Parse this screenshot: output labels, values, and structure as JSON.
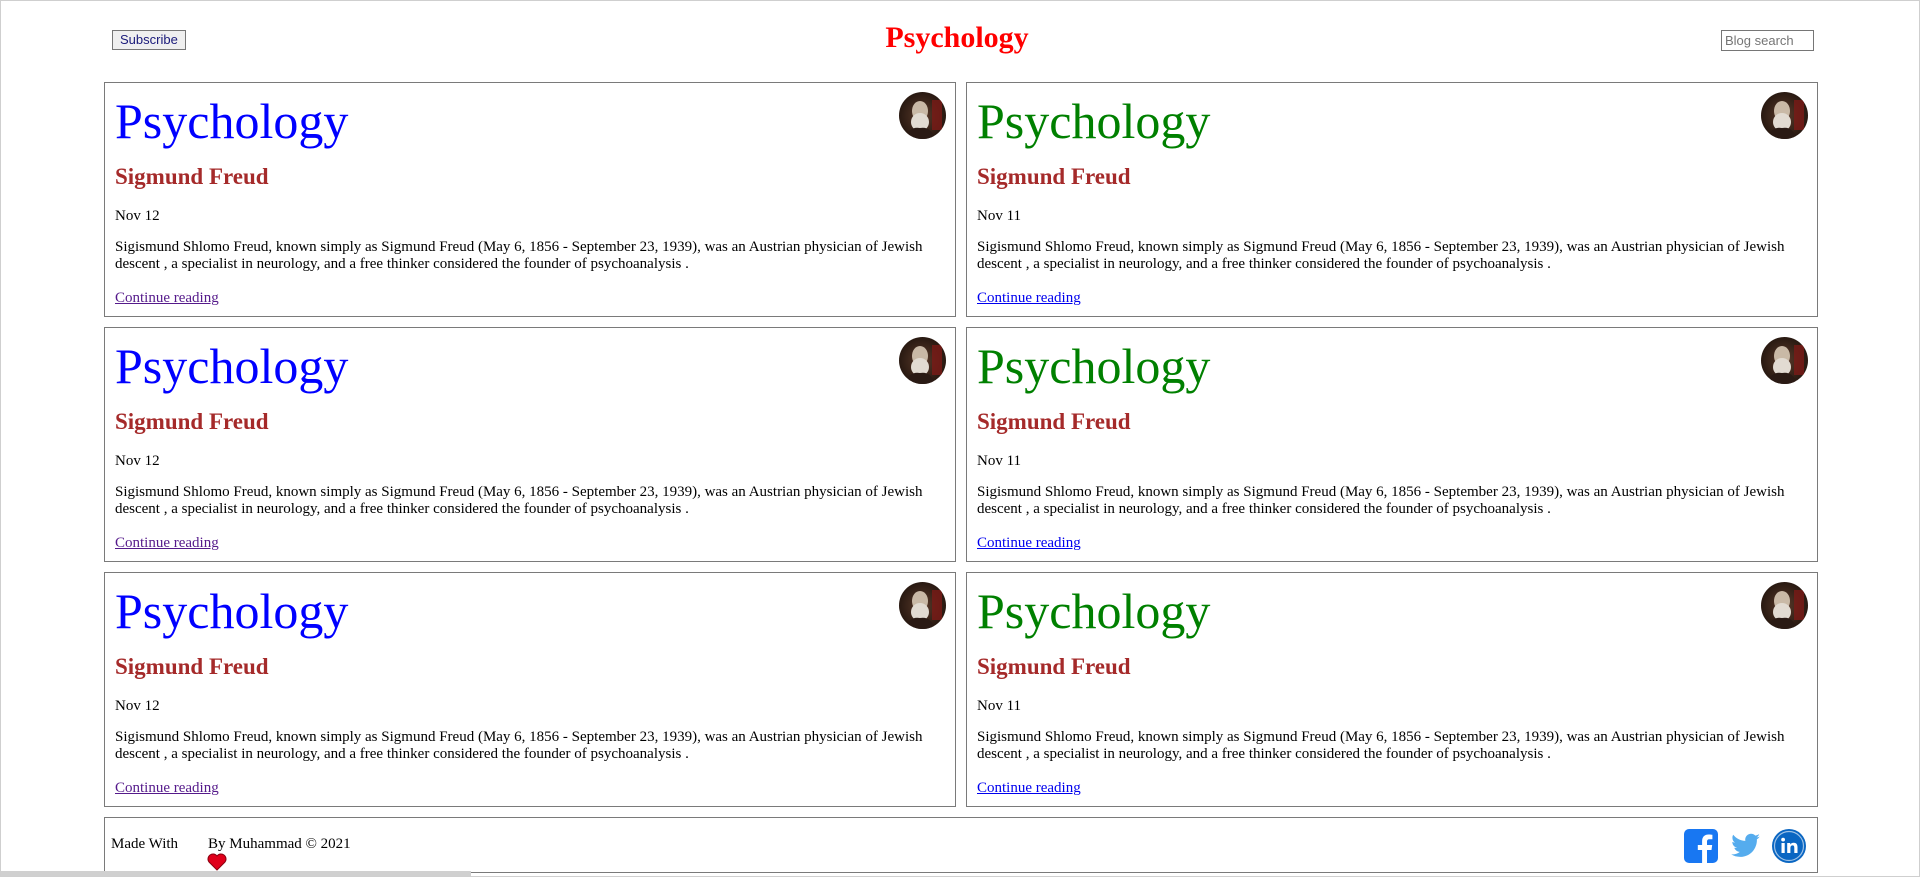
{
  "header": {
    "subscribe_label": "Subscribe",
    "site_title": "Psychology",
    "search_placeholder": "Blog search"
  },
  "posts": [
    {
      "heading": "Psychology",
      "author": "Sigmund Freud",
      "date": "Nov 12",
      "excerpt": "Sigismund Shlomo Freud, known simply as Sigmund Freud (May 6, 1856 - September 23, 1939), was an Austrian physician of Jewish descent , a specialist in neurology, and a free thinker considered the founder of psychoanalysis .",
      "link": "Continue reading"
    },
    {
      "heading": "Psychology",
      "author": "Sigmund Freud",
      "date": "Nov 11",
      "excerpt": "Sigismund Shlomo Freud, known simply as Sigmund Freud (May 6, 1856 - September 23, 1939), was an Austrian physician of Jewish descent , a specialist in neurology, and a free thinker considered the founder of psychoanalysis .",
      "link": "Continue reading"
    },
    {
      "heading": "Psychology",
      "author": "Sigmund Freud",
      "date": "Nov 12",
      "excerpt": "Sigismund Shlomo Freud, known simply as Sigmund Freud (May 6, 1856 - September 23, 1939), was an Austrian physician of Jewish descent , a specialist in neurology, and a free thinker considered the founder of psychoanalysis .",
      "link": "Continue reading"
    },
    {
      "heading": "Psychology",
      "author": "Sigmund Freud",
      "date": "Nov 11",
      "excerpt": "Sigismund Shlomo Freud, known simply as Sigmund Freud (May 6, 1856 - September 23, 1939), was an Austrian physician of Jewish descent , a specialist in neurology, and a free thinker considered the founder of psychoanalysis .",
      "link": "Continue reading"
    },
    {
      "heading": "Psychology",
      "author": "Sigmund Freud",
      "date": "Nov 12",
      "excerpt": "Sigismund Shlomo Freud, known simply as Sigmund Freud (May 6, 1856 - September 23, 1939), was an Austrian physician of Jewish descent , a specialist in neurology, and a free thinker considered the founder of psychoanalysis .",
      "link": "Continue reading"
    },
    {
      "heading": "Psychology",
      "author": "Sigmund Freud",
      "date": "Nov 11",
      "excerpt": "Sigismund Shlomo Freud, known simply as Sigmund Freud (May 6, 1856 - September 23, 1939), was an Austrian physician of Jewish descent , a specialist in neurology, and a free thinker considered the founder of psychoanalysis .",
      "link": "Continue reading"
    }
  ],
  "footer": {
    "made_with": "Made With",
    "by_text": "By Muhammad © 2021",
    "icons": [
      "heart-icon",
      "facebook-icon",
      "twitter-icon",
      "linkedin-icon"
    ]
  },
  "colors": {
    "title": "#ff0000",
    "heading_left": "#0000ff",
    "heading_right": "#008000",
    "author": "#a52a2a",
    "facebook": "#1877f2",
    "twitter": "#55acee",
    "linkedin": "#0a66c2"
  }
}
